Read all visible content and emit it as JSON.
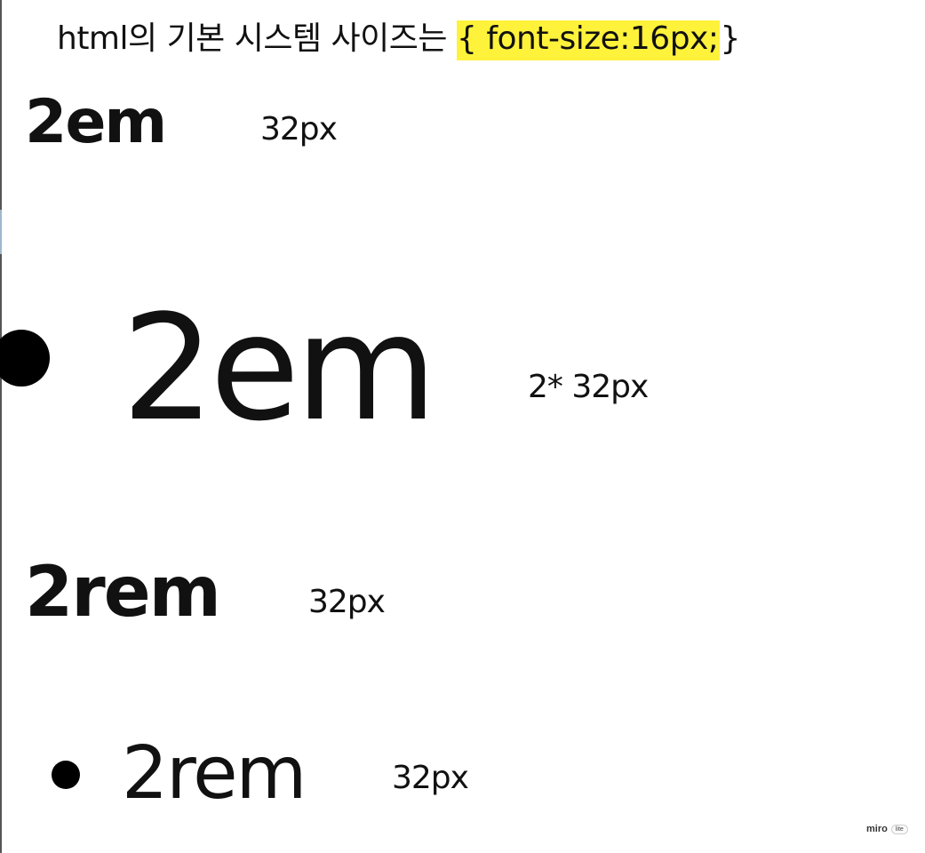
{
  "heading": {
    "prefix": "html의 기본 시스템 사이즈는 ",
    "highlight": "{ font-size:16px;",
    "suffix": "}",
    "highlight_color": "#fff23b"
  },
  "items": [
    {
      "label": "2em",
      "value": "32px"
    },
    {
      "label": "2em",
      "value": "2* 32px"
    },
    {
      "label": "2rem",
      "value": "32px"
    },
    {
      "label": "2rem",
      "value": "32px"
    }
  ],
  "branding": {
    "name": "miro",
    "badge": "lite"
  }
}
